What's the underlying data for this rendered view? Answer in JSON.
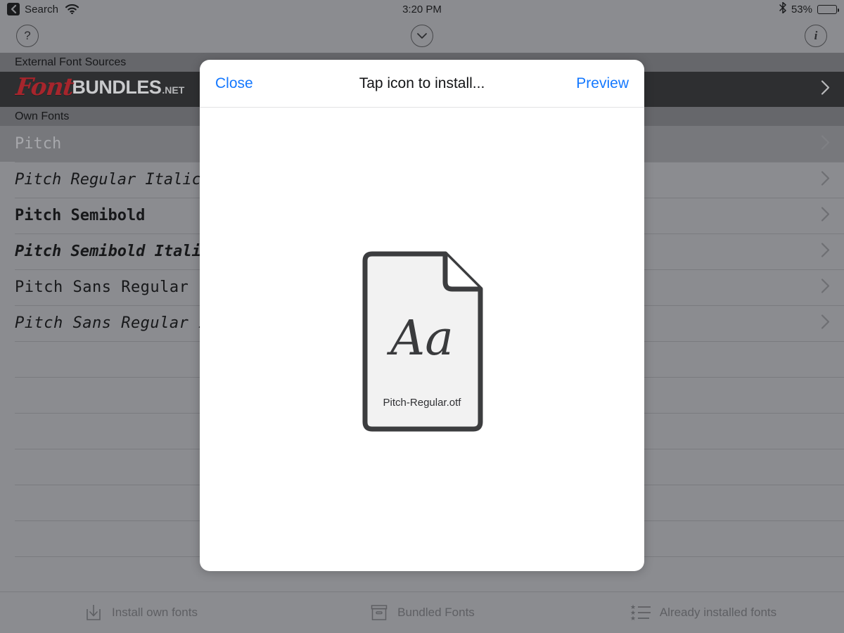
{
  "statusbar": {
    "back_label": "Search",
    "back_icon": "back-chevron-icon",
    "wifi_icon": "wifi-icon",
    "time": "3:20 PM",
    "bluetooth_icon": "bluetooth-icon",
    "battery_percent": "53%",
    "battery_level": 53
  },
  "navbar": {
    "help_label": "?",
    "help_icon": "question-mark-circle-icon",
    "check_icon": "chevron-down-circle-icon",
    "info_label": "i",
    "info_icon": "info-circle-icon"
  },
  "list": {
    "sections": [
      {
        "header": "External Font Sources",
        "rows": [
          {
            "type": "brand",
            "brand": {
              "script": "Font",
              "bold": "BUNDLES",
              "suffix": ".NET"
            },
            "chevron": "chevron-right-icon"
          }
        ]
      },
      {
        "header": "Own Fonts",
        "rows": [
          {
            "type": "font",
            "label": "Pitch",
            "style": "regular",
            "selected": true,
            "chevron": "chevron-right-icon"
          },
          {
            "type": "font",
            "label": "Pitch Regular Italic",
            "style": "italic",
            "selected": false,
            "chevron": "chevron-right-icon"
          },
          {
            "type": "font",
            "label": "Pitch Semibold",
            "style": "bold",
            "selected": false,
            "chevron": "chevron-right-icon"
          },
          {
            "type": "font",
            "label": "Pitch Semibold Italic",
            "style": "bold-italic",
            "selected": false,
            "chevron": "chevron-right-icon"
          },
          {
            "type": "font",
            "label": "Pitch Sans Regular",
            "style": "sans",
            "selected": false,
            "chevron": "chevron-right-icon"
          },
          {
            "type": "font",
            "label": "Pitch Sans Regular Italic",
            "style": "sans-italic",
            "selected": false,
            "chevron": "chevron-right-icon"
          },
          {
            "type": "empty",
            "label": ""
          },
          {
            "type": "empty",
            "label": ""
          },
          {
            "type": "empty",
            "label": ""
          },
          {
            "type": "empty",
            "label": ""
          },
          {
            "type": "empty",
            "label": ""
          },
          {
            "type": "empty",
            "label": ""
          },
          {
            "type": "empty",
            "label": ""
          }
        ]
      }
    ]
  },
  "modal": {
    "close_label": "Close",
    "title": "Tap icon to install...",
    "preview_label": "Preview",
    "document": {
      "icon": "font-file-document-icon",
      "sample_glyphs": "Aa",
      "filename": "Pitch-Regular.otf"
    }
  },
  "toolbar": {
    "items": [
      {
        "label": "Install own fonts",
        "icon": "download-into-tray-icon"
      },
      {
        "label": "Bundled Fonts",
        "icon": "archive-box-icon"
      },
      {
        "label": "Already installed fonts",
        "icon": "starred-list-icon"
      }
    ]
  },
  "colors": {
    "background": "#8b8c90",
    "section_header": "#66676b",
    "brand_row": "#2e2f31",
    "brand_red": "#a6252c",
    "accent_blue": "#1478ff",
    "modal_white": "#ffffff",
    "separator": "#7a7b7f"
  }
}
